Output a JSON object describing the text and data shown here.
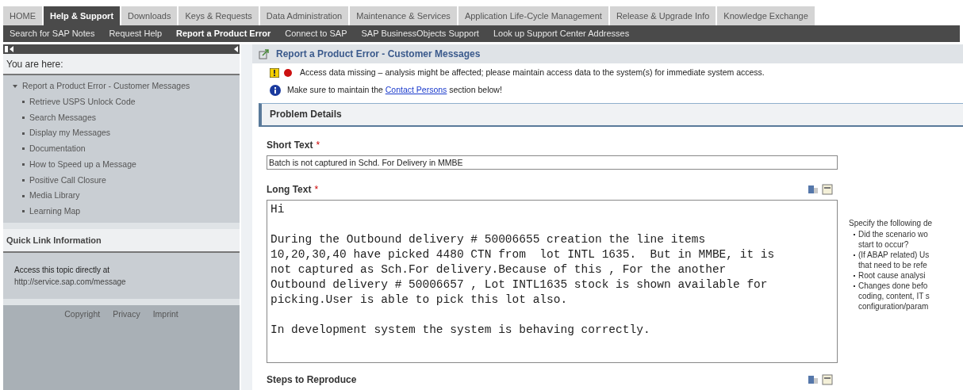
{
  "tabs": [
    {
      "label": "HOME",
      "selected": false
    },
    {
      "label": "Help & Support",
      "selected": true
    },
    {
      "label": "Downloads",
      "selected": false
    },
    {
      "label": "Keys & Requests",
      "selected": false
    },
    {
      "label": "Data Administration",
      "selected": false
    },
    {
      "label": "Maintenance & Services",
      "selected": false
    },
    {
      "label": "Application Life-Cycle Management",
      "selected": false
    },
    {
      "label": "Release & Upgrade Info",
      "selected": false
    },
    {
      "label": "Knowledge Exchange",
      "selected": false
    }
  ],
  "subnav": [
    {
      "label": "Search for SAP Notes",
      "selected": false
    },
    {
      "label": "Request Help",
      "selected": false
    },
    {
      "label": "Report a Product Error",
      "selected": true
    },
    {
      "label": "Connect to SAP",
      "selected": false
    },
    {
      "label": "SAP BusinessObjects Support",
      "selected": false
    },
    {
      "label": "Look up Support Center Addresses",
      "selected": false
    }
  ],
  "sidebar": {
    "breadcrumb_title": "You are here:",
    "tree": [
      {
        "label": "Report a Product Error - Customer Messages",
        "expanded": true,
        "children": [
          {
            "label": "Retrieve USPS Unlock Code"
          },
          {
            "label": "Search Messages"
          },
          {
            "label": "Display my Messages"
          },
          {
            "label": "Documentation"
          },
          {
            "label": "How to Speed up a Message"
          },
          {
            "label": "Positive Call Closure"
          },
          {
            "label": "Media Library"
          },
          {
            "label": "Learning Map"
          }
        ]
      }
    ],
    "quick_link": {
      "title": "Quick Link Information",
      "text": "Access this topic directly at",
      "url": "http://service.sap.com/message"
    },
    "footer_links": [
      "Copyright",
      "Privacy",
      "Imprint"
    ]
  },
  "main": {
    "title": "Report a Product Error - Customer Messages",
    "messages": [
      {
        "kind": "warning",
        "text": "Access data missing – analysis might be affected; please maintain access data to the system(s) for immediate system access."
      },
      {
        "kind": "info",
        "before": "Make sure to maintain the ",
        "link": "Contact Persons",
        "after": " section below!"
      }
    ],
    "section_title": "Problem Details",
    "short_text": {
      "label": "Short Text",
      "required_mark": "*",
      "value": "Batch is not captured in Schd. For Delivery in MMBE"
    },
    "long_text": {
      "label": "Long Text",
      "required_mark": "*",
      "value": "Hi\n\nDuring the Outbound delivery # 50006655 creation the line items\n10,20,30,40 have picked 4480 CTN from  lot INTL 1635.  But in MMBE, it is\nnot captured as Sch.For delivery.Because of this , For the another\nOutbound delivery # 50006657 , Lot INTL1635 stock is shown available for\npicking.User is able to pick this lot also.\n\nIn development system the system is behaving correctly."
    },
    "help": {
      "intro": "Specify the following de",
      "items": [
        [
          "Did the scenario wo",
          "start to occur?"
        ],
        [
          "(If ABAP related) Us",
          "that need to be refe"
        ],
        [
          "Root cause analysi"
        ],
        [
          "Changes done befo",
          "coding, content, IT s",
          "configuration/param"
        ]
      ]
    },
    "steps_label": "Steps to Reproduce"
  }
}
